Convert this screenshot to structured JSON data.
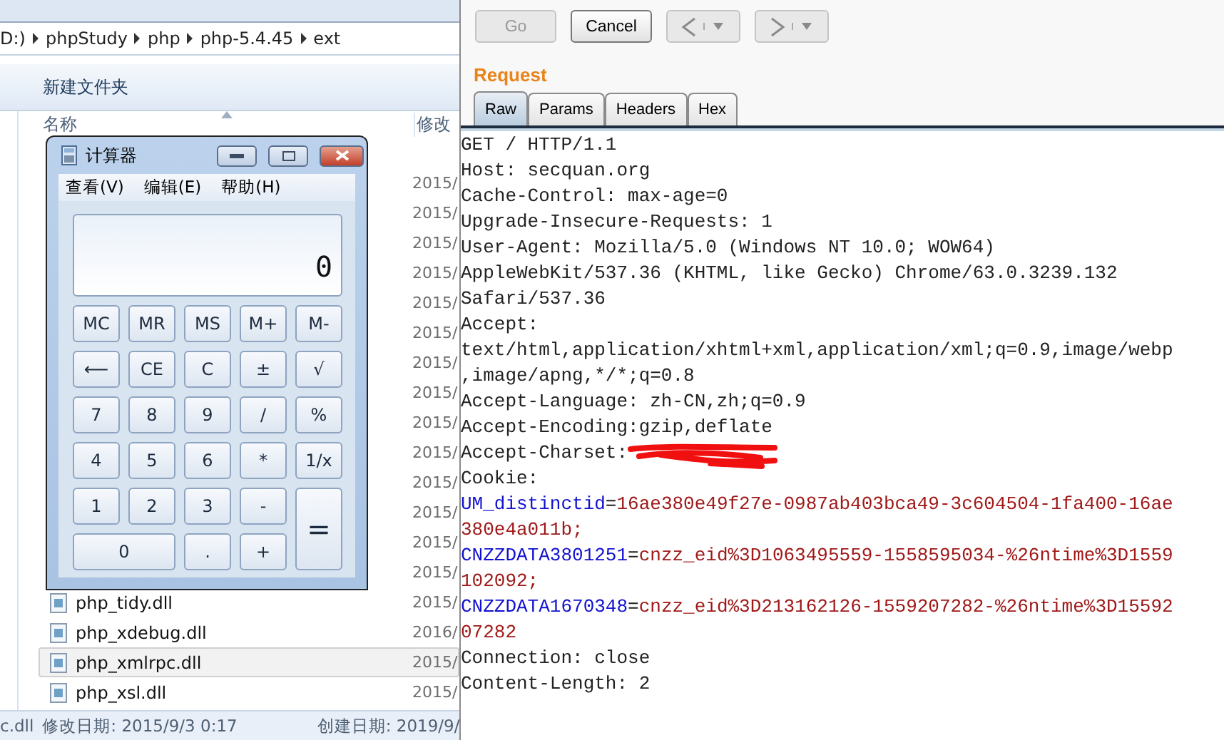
{
  "explorer": {
    "breadcrumbs": [
      "D:)",
      "phpStudy",
      "php",
      "php-5.4.45",
      "ext"
    ],
    "toolbar": {
      "new_folder": "新建文件夹"
    },
    "columns": [
      "名称",
      "修改"
    ],
    "rows": [
      {
        "date": "2015/",
        "selected": false
      },
      {
        "date": "2015/",
        "selected": false
      },
      {
        "date": "2015/",
        "selected": false
      },
      {
        "date": "2015/",
        "selected": false
      },
      {
        "date": "2015/",
        "selected": false
      },
      {
        "date": "2015/",
        "selected": false
      },
      {
        "date": "2015/",
        "selected": false
      },
      {
        "date": "2015/",
        "selected": false
      },
      {
        "date": "2015/",
        "selected": false
      },
      {
        "date": "2015/",
        "selected": false
      },
      {
        "date": "2015/",
        "selected": false
      },
      {
        "date": "2015/",
        "selected": false
      },
      {
        "date": "2015/",
        "selected": false
      },
      {
        "date": "2015/",
        "selected": false
      },
      {
        "name": "php_tidy.dll",
        "date": "2015/",
        "selected": false
      },
      {
        "name": "php_xdebug.dll",
        "date": "2016/",
        "selected": false
      },
      {
        "name": "php_xmlrpc.dll",
        "date": "2015/",
        "selected": true
      },
      {
        "name": "php_xsl.dll",
        "date": "2015/",
        "selected": false
      }
    ],
    "status": [
      "c.dll",
      "修改日期: 2015/9/3 0:17",
      "创建日期: 2019/9/"
    ]
  },
  "calculator": {
    "title": "计算器",
    "menu": [
      "查看(V)",
      "编辑(E)",
      "帮助(H)"
    ],
    "display": "0",
    "keys": [
      {
        "label": "MC",
        "kind": "key"
      },
      {
        "label": "MR",
        "kind": "key"
      },
      {
        "label": "MS",
        "kind": "key"
      },
      {
        "label": "M+",
        "kind": "key"
      },
      {
        "label": "M-",
        "kind": "key"
      },
      {
        "label": "⟵",
        "kind": "key"
      },
      {
        "label": "CE",
        "kind": "key"
      },
      {
        "label": "C",
        "kind": "key"
      },
      {
        "label": "±",
        "kind": "key"
      },
      {
        "label": "√",
        "kind": "key"
      },
      {
        "label": "7",
        "kind": "key"
      },
      {
        "label": "8",
        "kind": "key"
      },
      {
        "label": "9",
        "kind": "key"
      },
      {
        "label": "/",
        "kind": "key"
      },
      {
        "label": "%",
        "kind": "key"
      },
      {
        "label": "4",
        "kind": "key"
      },
      {
        "label": "5",
        "kind": "key"
      },
      {
        "label": "6",
        "kind": "key"
      },
      {
        "label": "*",
        "kind": "key"
      },
      {
        "label": "1/x",
        "kind": "key"
      },
      {
        "label": "1",
        "kind": "key"
      },
      {
        "label": "2",
        "kind": "key"
      },
      {
        "label": "3",
        "kind": "key"
      },
      {
        "label": "-",
        "kind": "key"
      },
      {
        "label": "=",
        "kind": "tall"
      },
      {
        "label": "0",
        "kind": "wide"
      },
      {
        "label": ".",
        "kind": "key"
      },
      {
        "label": "+",
        "kind": "key"
      }
    ]
  },
  "request_panel": {
    "buttons": [
      {
        "label": "Go",
        "disabled": true
      },
      {
        "label": "Cancel",
        "disabled": false
      }
    ],
    "nav": [
      {
        "kind": "back",
        "disabled": true
      },
      {
        "kind": "forward",
        "disabled": true
      }
    ],
    "title": "Request",
    "tabs": [
      {
        "label": "Raw",
        "selected": true
      },
      {
        "label": "Params",
        "selected": false
      },
      {
        "label": "Headers",
        "selected": false
      },
      {
        "label": "Hex",
        "selected": false
      }
    ],
    "lines": [
      {
        "segments": [
          {
            "text": "GET / HTTP/1.1",
            "kind": "plain"
          }
        ]
      },
      {
        "segments": [
          {
            "text": "Host: secquan.org",
            "kind": "plain"
          }
        ]
      },
      {
        "segments": [
          {
            "text": "Cache-Control: max-age=0",
            "kind": "plain"
          }
        ]
      },
      {
        "segments": [
          {
            "text": "Upgrade-Insecure-Requests: 1",
            "kind": "plain"
          }
        ]
      },
      {
        "segments": [
          {
            "text": "User-Agent: Mozilla/5.0 (Windows NT 10.0; WOW64)",
            "kind": "plain"
          }
        ]
      },
      {
        "segments": [
          {
            "text": "AppleWebKit/537.36 (KHTML, like Gecko) Chrome/63.0.3239.132",
            "kind": "plain"
          }
        ]
      },
      {
        "segments": [
          {
            "text": "Safari/537.36",
            "kind": "plain"
          }
        ]
      },
      {
        "segments": [
          {
            "text": "Accept:",
            "kind": "plain"
          }
        ]
      },
      {
        "segments": [
          {
            "text": "text/html,application/xhtml+xml,application/xml;q=0.9,image/webp",
            "kind": "plain"
          }
        ]
      },
      {
        "segments": [
          {
            "text": ",image/apng,*/*;q=0.8",
            "kind": "plain"
          }
        ]
      },
      {
        "segments": [
          {
            "text": "Accept-Language: zh-CN,zh;q=0.9",
            "kind": "plain"
          }
        ]
      },
      {
        "segments": [
          {
            "text": "Accept-Encoding:gzip,deflate",
            "kind": "plain"
          }
        ]
      },
      {
        "segments": [
          {
            "text": "Accept-Charset:",
            "kind": "plain"
          }
        ],
        "redacted": true
      },
      {
        "segments": [
          {
            "text": "Cookie:",
            "kind": "plain"
          }
        ]
      },
      {
        "segments": [
          {
            "text": "UM_distinctid",
            "kind": "name"
          },
          {
            "text": "=",
            "kind": "plain"
          },
          {
            "text": "16ae380e49f27e-0987ab403bca49-3c604504-1fa400-16ae",
            "kind": "value"
          }
        ]
      },
      {
        "segments": [
          {
            "text": "380e4a011b;",
            "kind": "value"
          }
        ]
      },
      {
        "segments": [
          {
            "text": "CNZZDATA3801251",
            "kind": "name"
          },
          {
            "text": "=",
            "kind": "plain"
          },
          {
            "text": "cnzz_eid%3D1063495559-1558595034-%26ntime%3D1559",
            "kind": "value"
          }
        ]
      },
      {
        "segments": [
          {
            "text": "102092;",
            "kind": "value"
          }
        ]
      },
      {
        "segments": [
          {
            "text": "CNZZDATA1670348",
            "kind": "name"
          },
          {
            "text": "=",
            "kind": "plain"
          },
          {
            "text": "cnzz_eid%3D213162126-1559207282-%26ntime%3D15592",
            "kind": "value"
          }
        ]
      },
      {
        "segments": [
          {
            "text": "07282",
            "kind": "value"
          }
        ]
      },
      {
        "segments": [
          {
            "text": "Connection: close",
            "kind": "plain"
          }
        ]
      },
      {
        "segments": [
          {
            "text": "Content-Length: 2",
            "kind": "plain"
          }
        ]
      }
    ]
  }
}
